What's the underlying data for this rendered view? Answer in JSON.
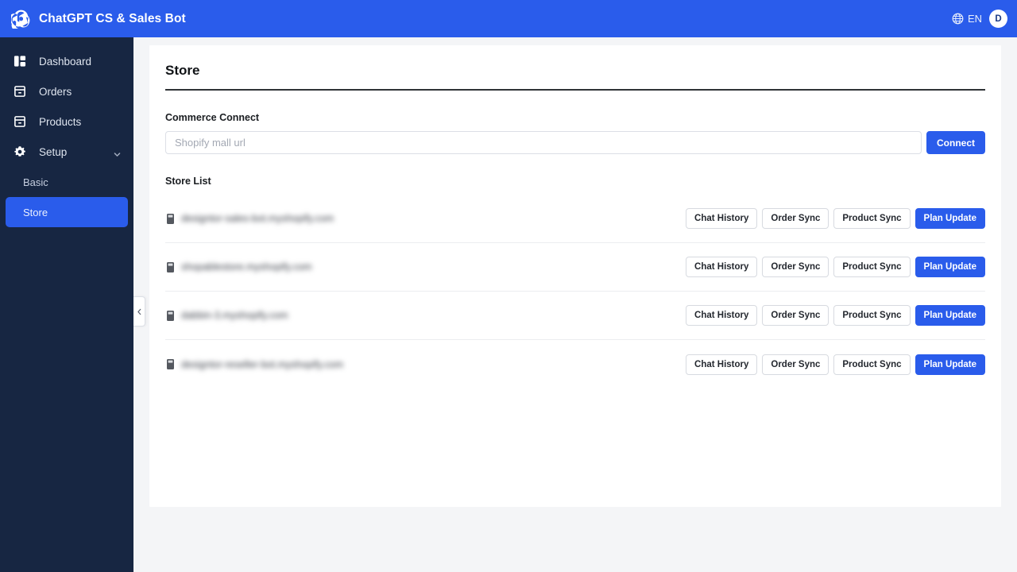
{
  "header": {
    "brand_title": "ChatGPT CS & Sales Bot",
    "logo_icon": "openai-swirl-icon",
    "globe_icon": "globe-icon",
    "language": "EN",
    "avatar_initial": "D"
  },
  "sidebar": {
    "items": [
      {
        "label": "Dashboard",
        "icon": "dashboard-grid-icon",
        "has_caret": false
      },
      {
        "label": "Orders",
        "icon": "orders-box-icon",
        "has_caret": false
      },
      {
        "label": "Products",
        "icon": "products-box-icon",
        "has_caret": false
      },
      {
        "label": "Setup",
        "icon": "gear-icon",
        "has_caret": true
      }
    ],
    "sub_items": [
      {
        "label": "Basic",
        "active": false
      },
      {
        "label": "Store",
        "active": true
      }
    ],
    "toggle_icon": "chevron-left-icon"
  },
  "main": {
    "page_title": "Store",
    "commerce_connect": {
      "label": "Commerce Connect",
      "input_value": "",
      "input_placeholder": "Shopify mall url",
      "connect_label": "Connect"
    },
    "store_list": {
      "label": "Store List",
      "actions": {
        "chat_history": "Chat History",
        "order_sync": "Order Sync",
        "product_sync": "Product Sync",
        "plan_update": "Plan Update"
      },
      "rows": [
        {
          "url": "designtor-sales-bot.myshopify.com",
          "favicon": "store-favicon-icon"
        },
        {
          "url": "shopablestore.myshopify.com",
          "favicon": "store-favicon-icon"
        },
        {
          "url": "dabbin-3.myshopify.com",
          "favicon": "store-favicon-icon"
        },
        {
          "url": "designtor-reseller-bot.myshopify.com",
          "favicon": "store-favicon-icon"
        }
      ]
    }
  },
  "colors": {
    "brand_blue": "#2a5ceb",
    "sidebar_navy": "#172642",
    "page_bg": "#f4f5f7",
    "card_bg": "#ffffff"
  }
}
